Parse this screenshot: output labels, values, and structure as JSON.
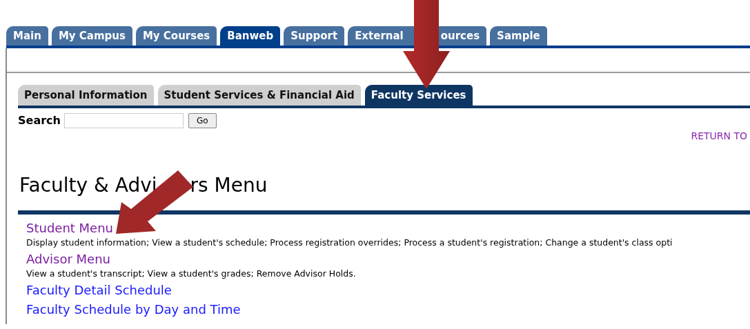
{
  "top_tabs": [
    {
      "label": [
        "Main"
      ],
      "selected": false
    },
    {
      "label": [
        "My Campus"
      ],
      "selected": false
    },
    {
      "label": [
        "My Courses"
      ],
      "selected": false
    },
    {
      "label": [
        "Banweb"
      ],
      "selected": true
    },
    {
      "label": [
        "Support"
      ],
      "selected": false
    },
    {
      "label": [
        "External",
        "ources"
      ],
      "selected": false
    },
    {
      "label": [
        "Sample"
      ],
      "selected": false
    }
  ],
  "sub_tabs": [
    {
      "label": "Personal Information",
      "selected": false
    },
    {
      "label": "Student Services & Financial Aid",
      "selected": false
    },
    {
      "label": "Faculty Services",
      "selected": true
    }
  ],
  "search": {
    "label": "Search",
    "button": "Go"
  },
  "return_link": "RETURN TO",
  "heading": [
    "Faculty & Advi",
    "rs Menu"
  ],
  "menu": [
    {
      "title": "Student Menu",
      "visited": true,
      "description": "Display student information; View a student's schedule; Process registration overrides; Process a student's registration; Change a student's class opti"
    },
    {
      "title": "Advisor Menu",
      "visited": true,
      "description": "View a student's transcript; View a student's grades; Remove Advisor Holds."
    },
    {
      "title": "Faculty Detail Schedule",
      "visited": false
    },
    {
      "title": "Faculty Schedule by Day and Time",
      "visited": false
    }
  ]
}
